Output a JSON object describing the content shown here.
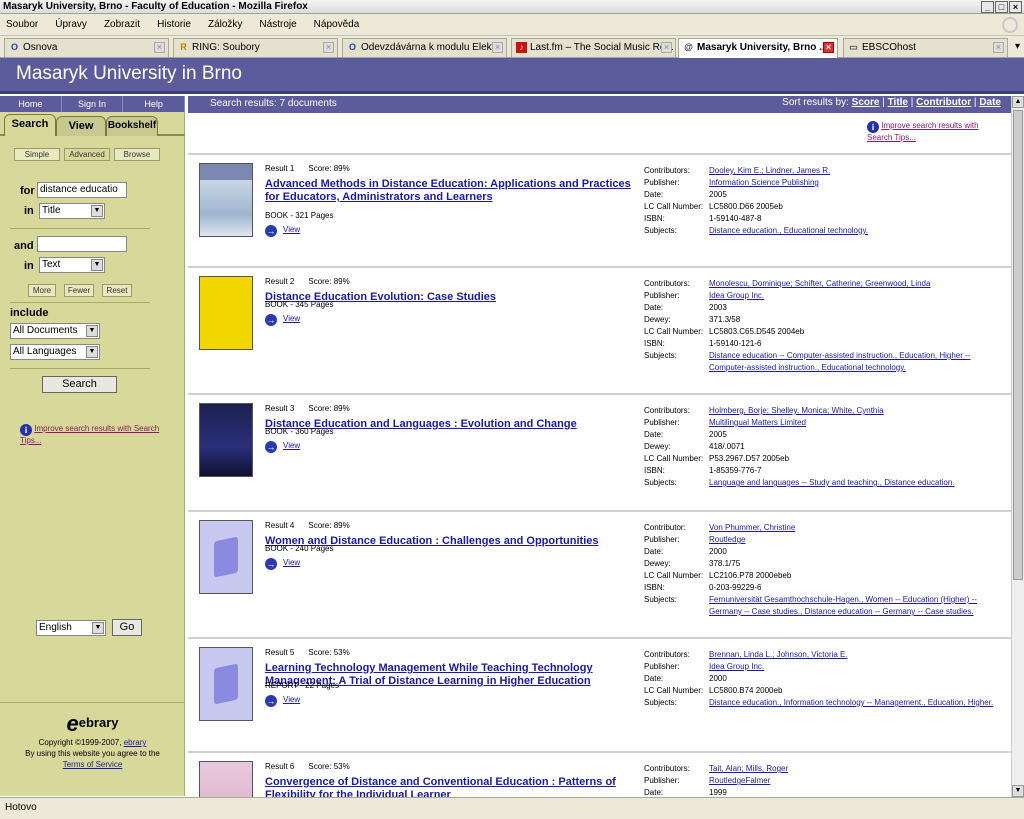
{
  "window": {
    "title": "Masaryk University, Brno - Faculty of Education - Mozilla Firefox"
  },
  "menubar": [
    "Soubor",
    "Úpravy",
    "Zobrazit",
    "Historie",
    "Záložky",
    "Nástroje",
    "Nápověda"
  ],
  "tabs": [
    {
      "label": "Osnova",
      "icon": "O"
    },
    {
      "label": "RING: Soubory",
      "icon": "R"
    },
    {
      "label": "Odevzdávárna k modulu Elekt...",
      "icon": "O"
    },
    {
      "label": "Last.fm – The Social Music Re...",
      "icon": "♪"
    },
    {
      "label": "Masaryk University, Brno ...",
      "icon": "@"
    },
    {
      "label": "EBSCOhost",
      "icon": "▭"
    }
  ],
  "header": {
    "title": "Masaryk University in Brno"
  },
  "left": {
    "topnav": [
      "Home",
      "Sign In",
      "Help"
    ],
    "tabs": [
      "Search",
      "View",
      "Bookshelf"
    ],
    "modes": [
      "Simple",
      "Advanced",
      "Browse"
    ],
    "for_label": "for",
    "in_label": "in",
    "and_label": "and",
    "query1": "distance educatio",
    "field1": "Title",
    "query2": "",
    "field2": "Text",
    "more": "More",
    "fewer": "Fewer",
    "reset": "Reset",
    "include_label": "include",
    "doc_filter": "All Documents",
    "lang_filter": "All Languages",
    "search_button": "Search",
    "tips": "Improve search results with Search Tips...",
    "language": "English",
    "go_button": "Go",
    "logo": "ebrary",
    "copyright": "Copyright ©1999-2007,",
    "copyright_link": "ebrary",
    "agree": "By using this website you agree to the",
    "tos": "Terms of Service"
  },
  "results_header": {
    "summary": "Search results: 7 documents",
    "sort_label": "Sort results by:",
    "sort_options": [
      "Score",
      "Title",
      "Contributor",
      "Date"
    ]
  },
  "tips_right": "Improve search results with Search Tips...",
  "results": [
    {
      "label": "Result 1",
      "score": "Score: 89%",
      "title": "Advanced Methods in Distance Education: Applications and Practices for Educators, Administrators and Learners",
      "type": "BOOK - 321 Pages",
      "view": "View",
      "details": [
        {
          "k": "Contributors:",
          "v": "Dooley, Kim E.; Lindner, James R.",
          "link": true
        },
        {
          "k": "Publisher:",
          "v": "Information Science Publishing",
          "link": true
        },
        {
          "k": "Date:",
          "v": "2005",
          "link": false
        },
        {
          "k": "LC Call Number:",
          "v": "LC5800.D66 2005eb",
          "link": false
        },
        {
          "k": "ISBN:",
          "v": "1-59140-487-8",
          "link": false
        },
        {
          "k": "Subjects:",
          "v": "Distance education., Educational technology.",
          "link": true
        }
      ]
    },
    {
      "label": "Result 2",
      "score": "Score: 89%",
      "title": "Distance Education Evolution: Case Studies",
      "type": "BOOK - 345 Pages",
      "view": "View",
      "details": [
        {
          "k": "Contributors:",
          "v": "Monolescu, Dominique; Schifter, Catherine; Greenwood, Linda",
          "link": true
        },
        {
          "k": "Publisher:",
          "v": "Idea Group Inc.",
          "link": true
        },
        {
          "k": "Date:",
          "v": "2003",
          "link": false
        },
        {
          "k": "Dewey:",
          "v": "371.3/58",
          "link": false
        },
        {
          "k": "LC Call Number:",
          "v": "LC5803.C65.D545 2004eb",
          "link": false
        },
        {
          "k": "ISBN:",
          "v": "1-59140-121-6",
          "link": false
        },
        {
          "k": "Subjects:",
          "v": "Distance education -- Computer-assisted instruction., Education, Higher -- Computer-assisted instruction., Educational technology.",
          "link": true
        }
      ]
    },
    {
      "label": "Result 3",
      "score": "Score: 89%",
      "title": "Distance Education and Languages : Evolution and Change",
      "type": "BOOK - 360 Pages",
      "view": "View",
      "details": [
        {
          "k": "Contributors:",
          "v": "Holmberg, Borje; Shelley, Monica; White, Cynthia",
          "link": true
        },
        {
          "k": "Publisher:",
          "v": "Multilingual Matters Limited",
          "link": true
        },
        {
          "k": "Date:",
          "v": "2005",
          "link": false
        },
        {
          "k": "Dewey:",
          "v": "418/.0071",
          "link": false
        },
        {
          "k": "LC Call Number:",
          "v": "P53.2967.D57 2005eb",
          "link": false
        },
        {
          "k": "ISBN:",
          "v": "1-85359-776-7",
          "link": false
        },
        {
          "k": "Subjects:",
          "v": "Language and languages -- Study and teaching., Distance education.",
          "link": true
        }
      ]
    },
    {
      "label": "Result 4",
      "score": "Score: 89%",
      "title": "Women and Distance Education : Challenges and Opportunities",
      "type": "BOOK - 240 Pages",
      "view": "View",
      "details": [
        {
          "k": "Contributor:",
          "v": "Von Phummer, Christine",
          "link": true
        },
        {
          "k": "Publisher:",
          "v": "Routledge",
          "link": true
        },
        {
          "k": "Date:",
          "v": "2000",
          "link": false
        },
        {
          "k": "Dewey:",
          "v": "378.1/75",
          "link": false
        },
        {
          "k": "LC Call Number:",
          "v": "LC2106.P78 2000ebeb",
          "link": false
        },
        {
          "k": "ISBN:",
          "v": "0-203-99229-6",
          "link": false
        },
        {
          "k": "Subjects:",
          "v": "Fernuniversität Gesamthochschule-Hagen., Women -- Education (Higher) -- Germany -- Case studies., Distance education -- Germany -- Case studies.",
          "link": true
        }
      ]
    },
    {
      "label": "Result 5",
      "score": "Score: 53%",
      "title": "Learning Technology Management While Teaching Technology Management: A Trial of Distance Learning in Higher Education",
      "type": "REPORT - 22 Pages",
      "view": "View",
      "details": [
        {
          "k": "Contributors:",
          "v": "Brennan, Linda L.; Johnson, Victoria E.",
          "link": true
        },
        {
          "k": "Publisher:",
          "v": "Idea Group Inc.",
          "link": true
        },
        {
          "k": "Date:",
          "v": "2000",
          "link": false
        },
        {
          "k": "LC Call Number:",
          "v": "LC5800.B74 2000eb",
          "link": false
        },
        {
          "k": "Subjects:",
          "v": "Distance education., Information technology -- Management., Education, Higher.",
          "link": true
        }
      ]
    },
    {
      "label": "Result 6",
      "score": "Score: 53%",
      "title": "Convergence of Distance and Conventional Education : Patterns of Flexibility for the Individual Learner",
      "type": "",
      "view": "",
      "details": [
        {
          "k": "Contributors:",
          "v": "Tait, Alan; Mills, Roger",
          "link": true
        },
        {
          "k": "Publisher:",
          "v": "RoutledgeFalmer",
          "link": true
        },
        {
          "k": "Date:",
          "v": "1999",
          "link": false
        }
      ]
    }
  ],
  "status": "Hotovo"
}
